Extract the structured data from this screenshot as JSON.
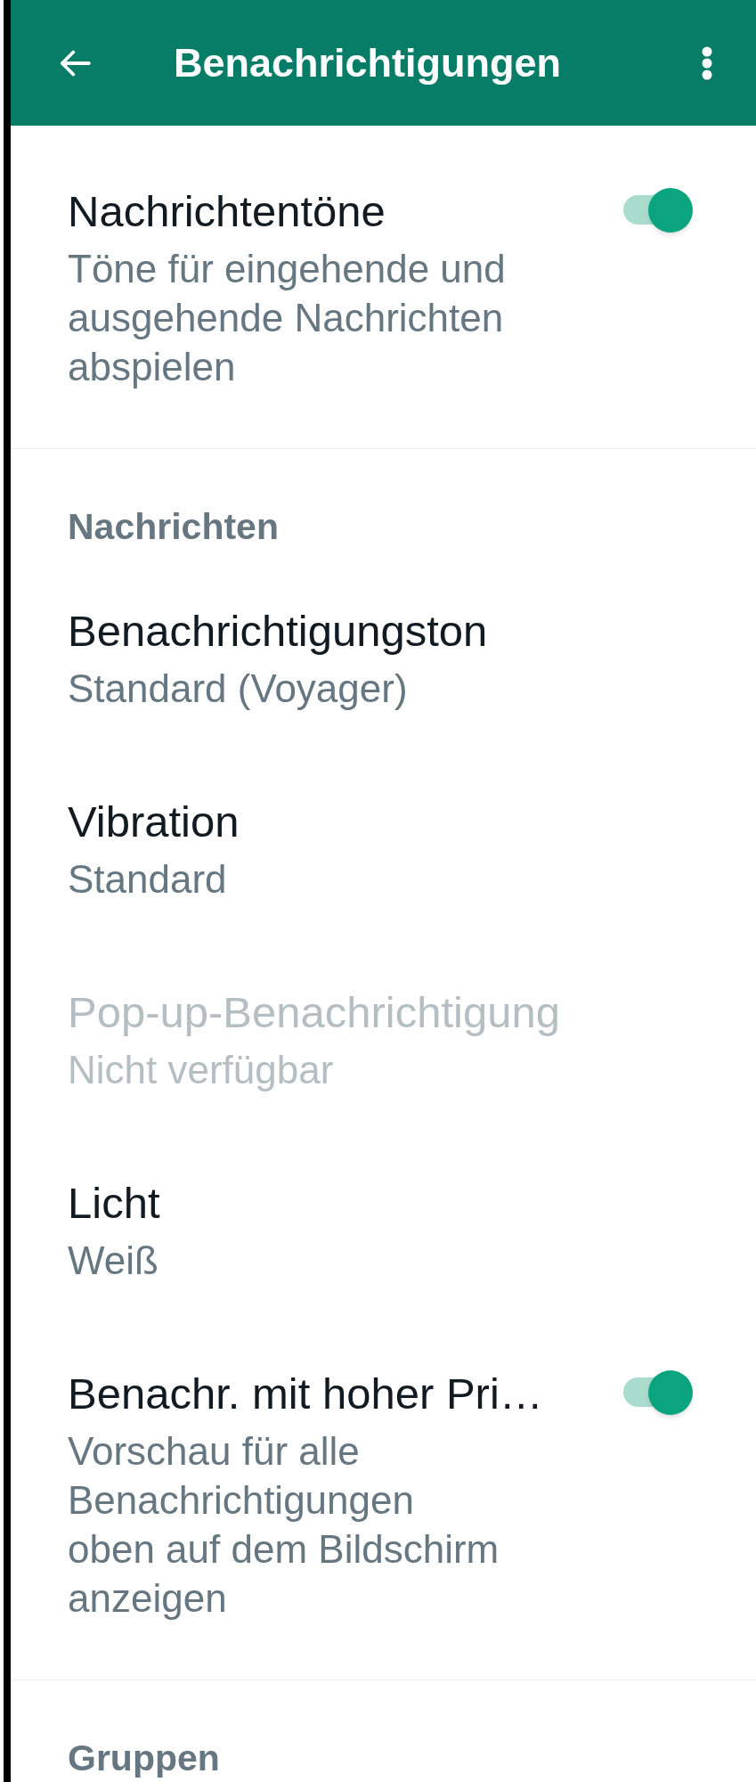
{
  "app_bar": {
    "title": "Benachrichtigungen"
  },
  "sections": [
    {
      "items": [
        {
          "kind": "switch",
          "title": "Nachrichtentöne",
          "subtitle": "Töne für eingehende und ausgehende Nachrichten abspielen",
          "on": true,
          "disabled": false
        }
      ]
    },
    {
      "header": "Nachrichten",
      "items": [
        {
          "kind": "option",
          "title": "Benachrichtigungston",
          "subtitle": "Standard (Voyager)",
          "disabled": false
        },
        {
          "kind": "option",
          "title": "Vibration",
          "subtitle": "Standard",
          "disabled": false
        },
        {
          "kind": "option",
          "title": "Pop-up-Benachrichtigung",
          "subtitle": "Nicht verfügbar",
          "disabled": true
        },
        {
          "kind": "option",
          "title": "Licht",
          "subtitle": "Weiß",
          "disabled": false
        },
        {
          "kind": "switch",
          "title": "Benachr. mit hoher Pri…",
          "subtitle": "Vorschau für alle Benachrichtigungen oben auf dem Bildschirm anzeigen",
          "on": true,
          "disabled": false
        }
      ]
    },
    {
      "header": "Gruppen"
    }
  ]
}
